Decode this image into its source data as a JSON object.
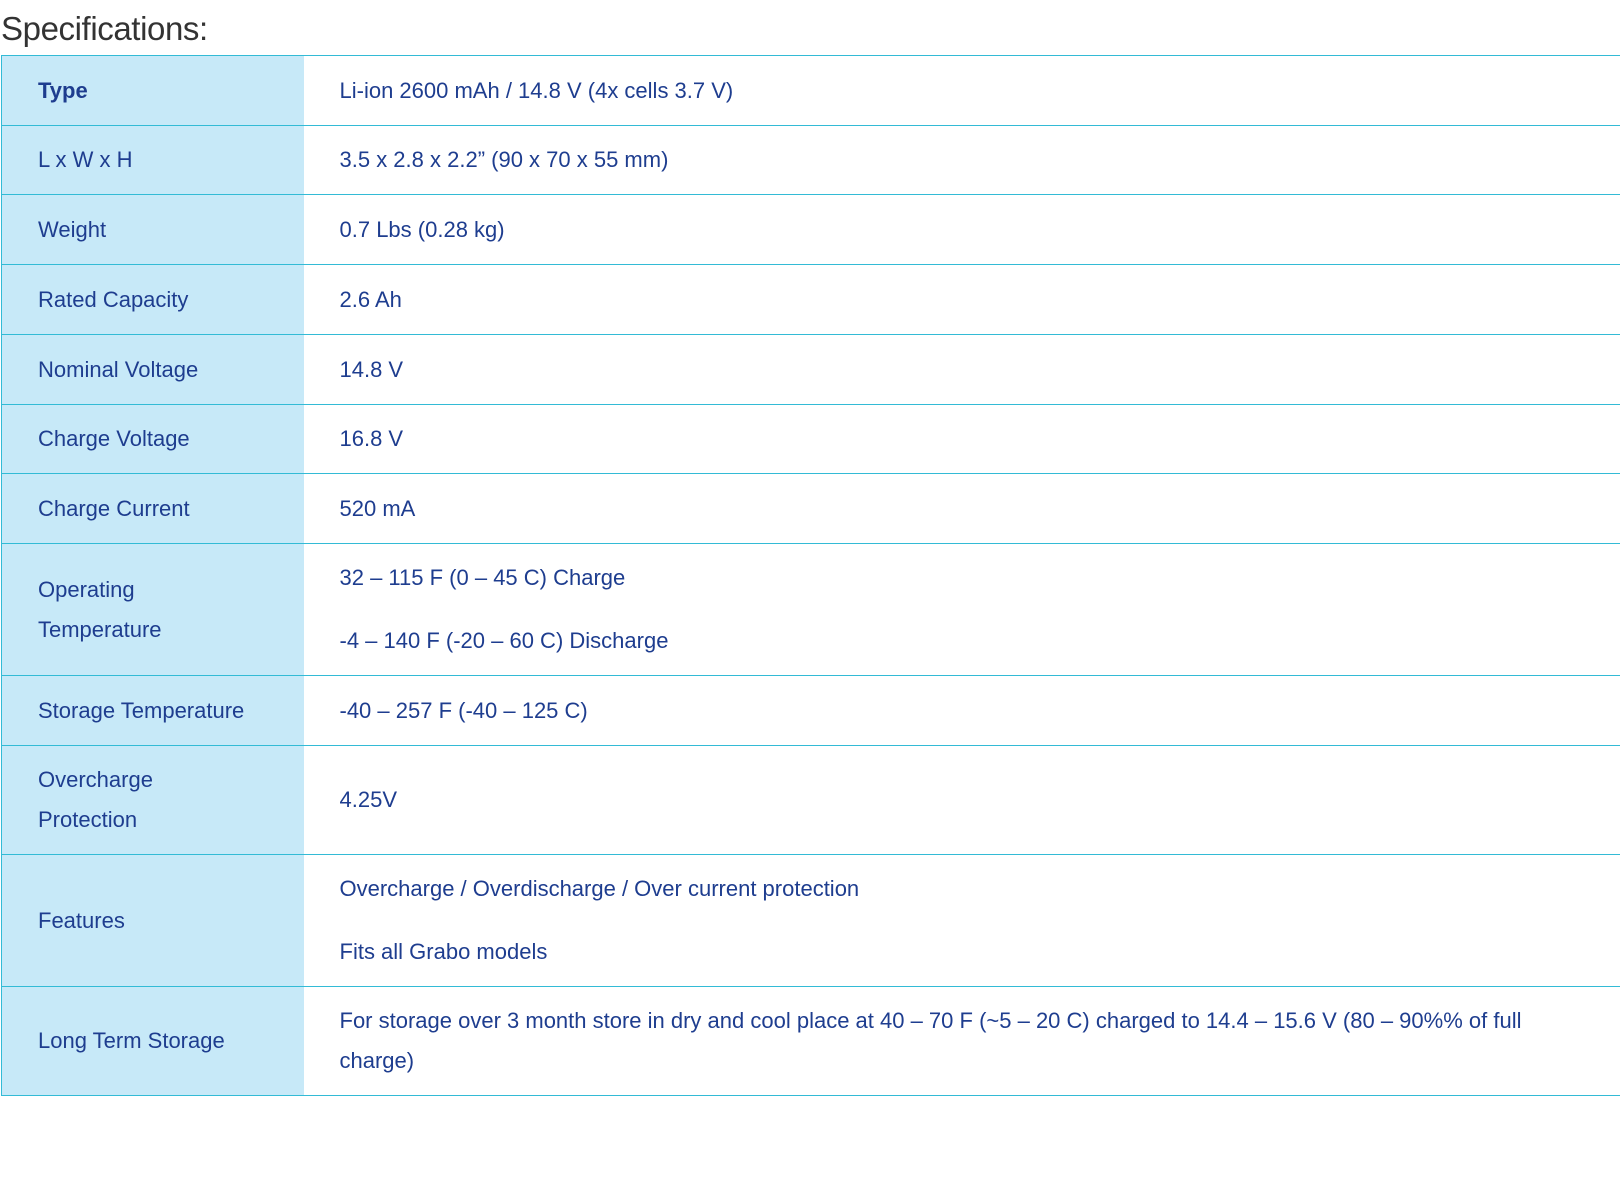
{
  "heading": "Specifications:",
  "rows": [
    {
      "label": "Type",
      "values": [
        "Li-ion 2600 mAh / 14.8 V (4x cells 3.7 V)"
      ]
    },
    {
      "label": "L x W x H",
      "values": [
        "3.5 x 2.8 x 2.2” (90 x 70 x 55 mm)"
      ]
    },
    {
      "label": "Weight",
      "values": [
        "0.7 Lbs (0.28 kg)"
      ]
    },
    {
      "label": "Rated Capacity",
      "values": [
        "2.6 Ah"
      ]
    },
    {
      "label": "Nominal Voltage",
      "values": [
        "14.8 V"
      ]
    },
    {
      "label": "Charge Voltage",
      "values": [
        "16.8 V"
      ]
    },
    {
      "label": "Charge Current",
      "values": [
        "520 mA"
      ]
    },
    {
      "label": "Operating Temperature",
      "values": [
        "32 – 115 F (0 – 45 C) Charge",
        "-4 – 140 F (-20 – 60 C) Discharge"
      ]
    },
    {
      "label": "Storage Temperature",
      "values": [
        "-40 – 257 F (-40 – 125 C)"
      ]
    },
    {
      "label": "Overcharge Protection",
      "values": [
        "4.25V"
      ]
    },
    {
      "label": "Features",
      "values": [
        "Overcharge / Overdischarge / Over current protection",
        "Fits all Grabo models"
      ]
    },
    {
      "label": "Long Term Storage",
      "values": [
        "For storage over 3 month store in dry and cool place at 40 – 70 F (~5 – 20 C) charged to 14.4 – 15.6 V (80 – 90%% of full charge)"
      ]
    }
  ],
  "colors": {
    "label_background": "#c7e9f8",
    "border": "#33bbd6",
    "text": "#1e3d8f",
    "heading_text": "#333333"
  }
}
